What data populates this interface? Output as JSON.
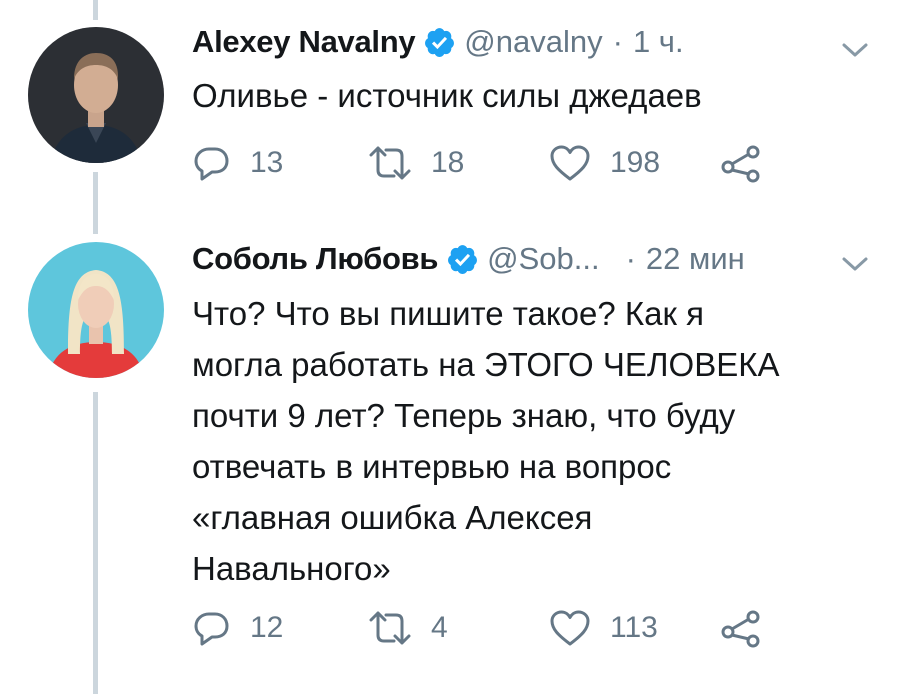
{
  "tweets": [
    {
      "author_name": "Alexey Navalny",
      "handle": "@navalny",
      "separator": "·",
      "time": "1 ч.",
      "text_lines": [
        "Оливье - источник силы джедаев"
      ],
      "replies": "13",
      "retweets": "18",
      "likes": "198",
      "avatar_bg": "#3a3d44",
      "verified_color": "#1da1f2"
    },
    {
      "author_name": "Соболь Любовь",
      "handle": "@Sob...",
      "separator": "·",
      "time": "22 мин",
      "text_lines": [
        "Что? Что вы пишите такое? Как я",
        "могла работать на ЭТОГО ЧЕЛОВЕКА",
        "почти 9 лет? Теперь знаю, что буду",
        "отвечать в интервью на вопрос",
        "«главная ошибка Алексея",
        "Навального»"
      ],
      "replies": "12",
      "retweets": "4",
      "likes": "113",
      "avatar_bg": "#5ec6dc",
      "verified_color": "#1da1f2"
    }
  ],
  "icons": {
    "reply": "reply-icon",
    "retweet": "retweet-icon",
    "like": "heart-icon",
    "share": "share-icon",
    "more": "chevron-down-icon",
    "verified": "verified-badge-icon"
  },
  "colors": {
    "thread_line": "#ccd6dd",
    "muted_text": "#657786",
    "primary_text": "#14171a",
    "accent": "#1da1f2"
  }
}
